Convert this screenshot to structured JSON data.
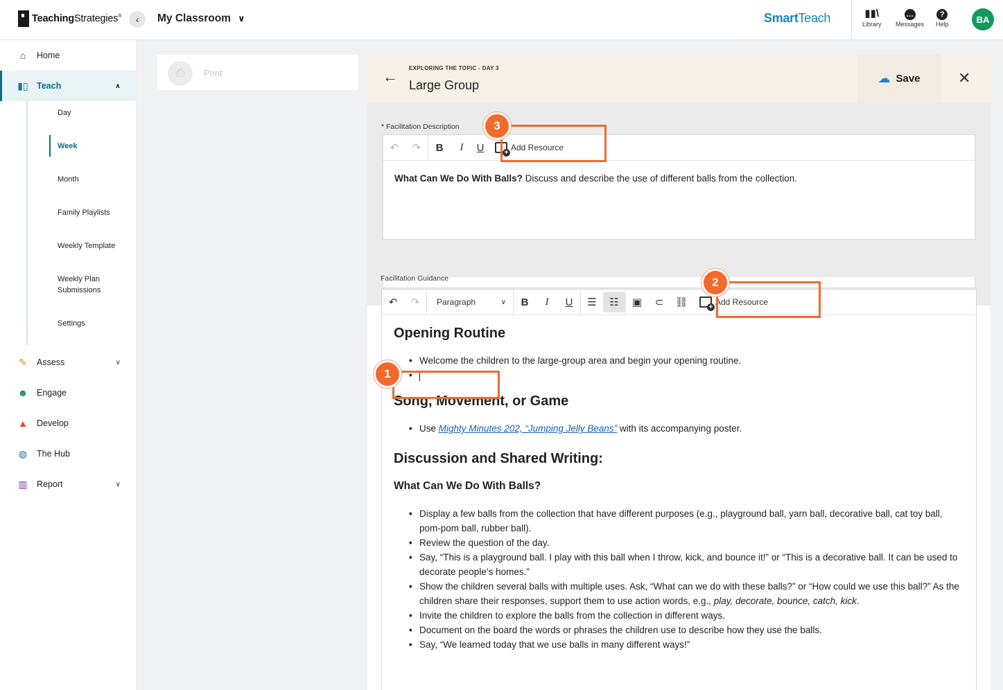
{
  "header": {
    "logo_bold": "Teaching",
    "logo_light": "Strategies",
    "logo_mark": "®",
    "classroom": "My Classroom",
    "brand_smart": "Smart",
    "brand_teach": "Teach",
    "library": "Library",
    "messages": "Messages",
    "help": "Help",
    "avatar": "BA"
  },
  "sidebar": {
    "home": "Home",
    "teach": "Teach",
    "teach_sub": [
      "Day",
      "Week",
      "Month",
      "Family Playlists",
      "Weekly Template",
      "Weekly Plan Submissions",
      "Settings"
    ],
    "assess": "Assess",
    "engage": "Engage",
    "develop": "Develop",
    "hub": "The Hub",
    "report": "Report"
  },
  "print": {
    "label": "Print"
  },
  "editor": {
    "kicker": "EXPLORING THE TOPIC - DAY 3",
    "title": "Large Group",
    "save": "Save",
    "desc_label": "* Facilitation Description",
    "add_resource": "Add Resource",
    "desc_bold": "What Can We Do With Balls?",
    "desc_rest": " Discuss and describe the use of different balls from the collection.",
    "guide_label": "Facilitation Guidance",
    "paragraph": "Paragraph",
    "h_opening": "Opening Routine",
    "opening_1": "Welcome the children to the large-group area and begin your opening routine.",
    "h_song": "Song, Movement, or Game",
    "song_use": "Use ",
    "song_link": "Mighty Minutes 202, “Jumping Jelly Beans”",
    "song_rest": " with its accompanying poster.",
    "h_discussion": "Discussion and Shared Writing:",
    "h_balls": "What Can We Do With Balls?",
    "d1": "Display a few balls from the collection that have different purposes (e.g., playground ball, yarn ball, decorative ball, cat toy ball, pom-pom ball, rubber ball).",
    "d2": "Review the question of the day.",
    "d3": "Say, “This is a playground ball. I play with this ball when I throw, kick, and bounce it!” or “This is a decorative ball. It can be used to decorate people’s homes.”",
    "d4_a": "Show the children several balls with multiple uses. Ask, “What can we do with these balls?” or “How could we use this ball?” As the children share their responses, support them to use action words, e.g., ",
    "d4_b": "play, decorate, bounce, catch, kick",
    "d4_c": ".",
    "d5": "Invite the children to explore the balls from the collection in different ways.",
    "d6": "Document on the board the words or phrases the children use to describe how they use the balls.",
    "d7": "Say, “We learned today that we use balls in many different ways!”"
  },
  "callouts": {
    "one": "1",
    "two": "2",
    "three": "3"
  },
  "colors": {
    "accent": "#0b6e86",
    "callout": "#f26a2b",
    "brand": "#1486c4"
  }
}
